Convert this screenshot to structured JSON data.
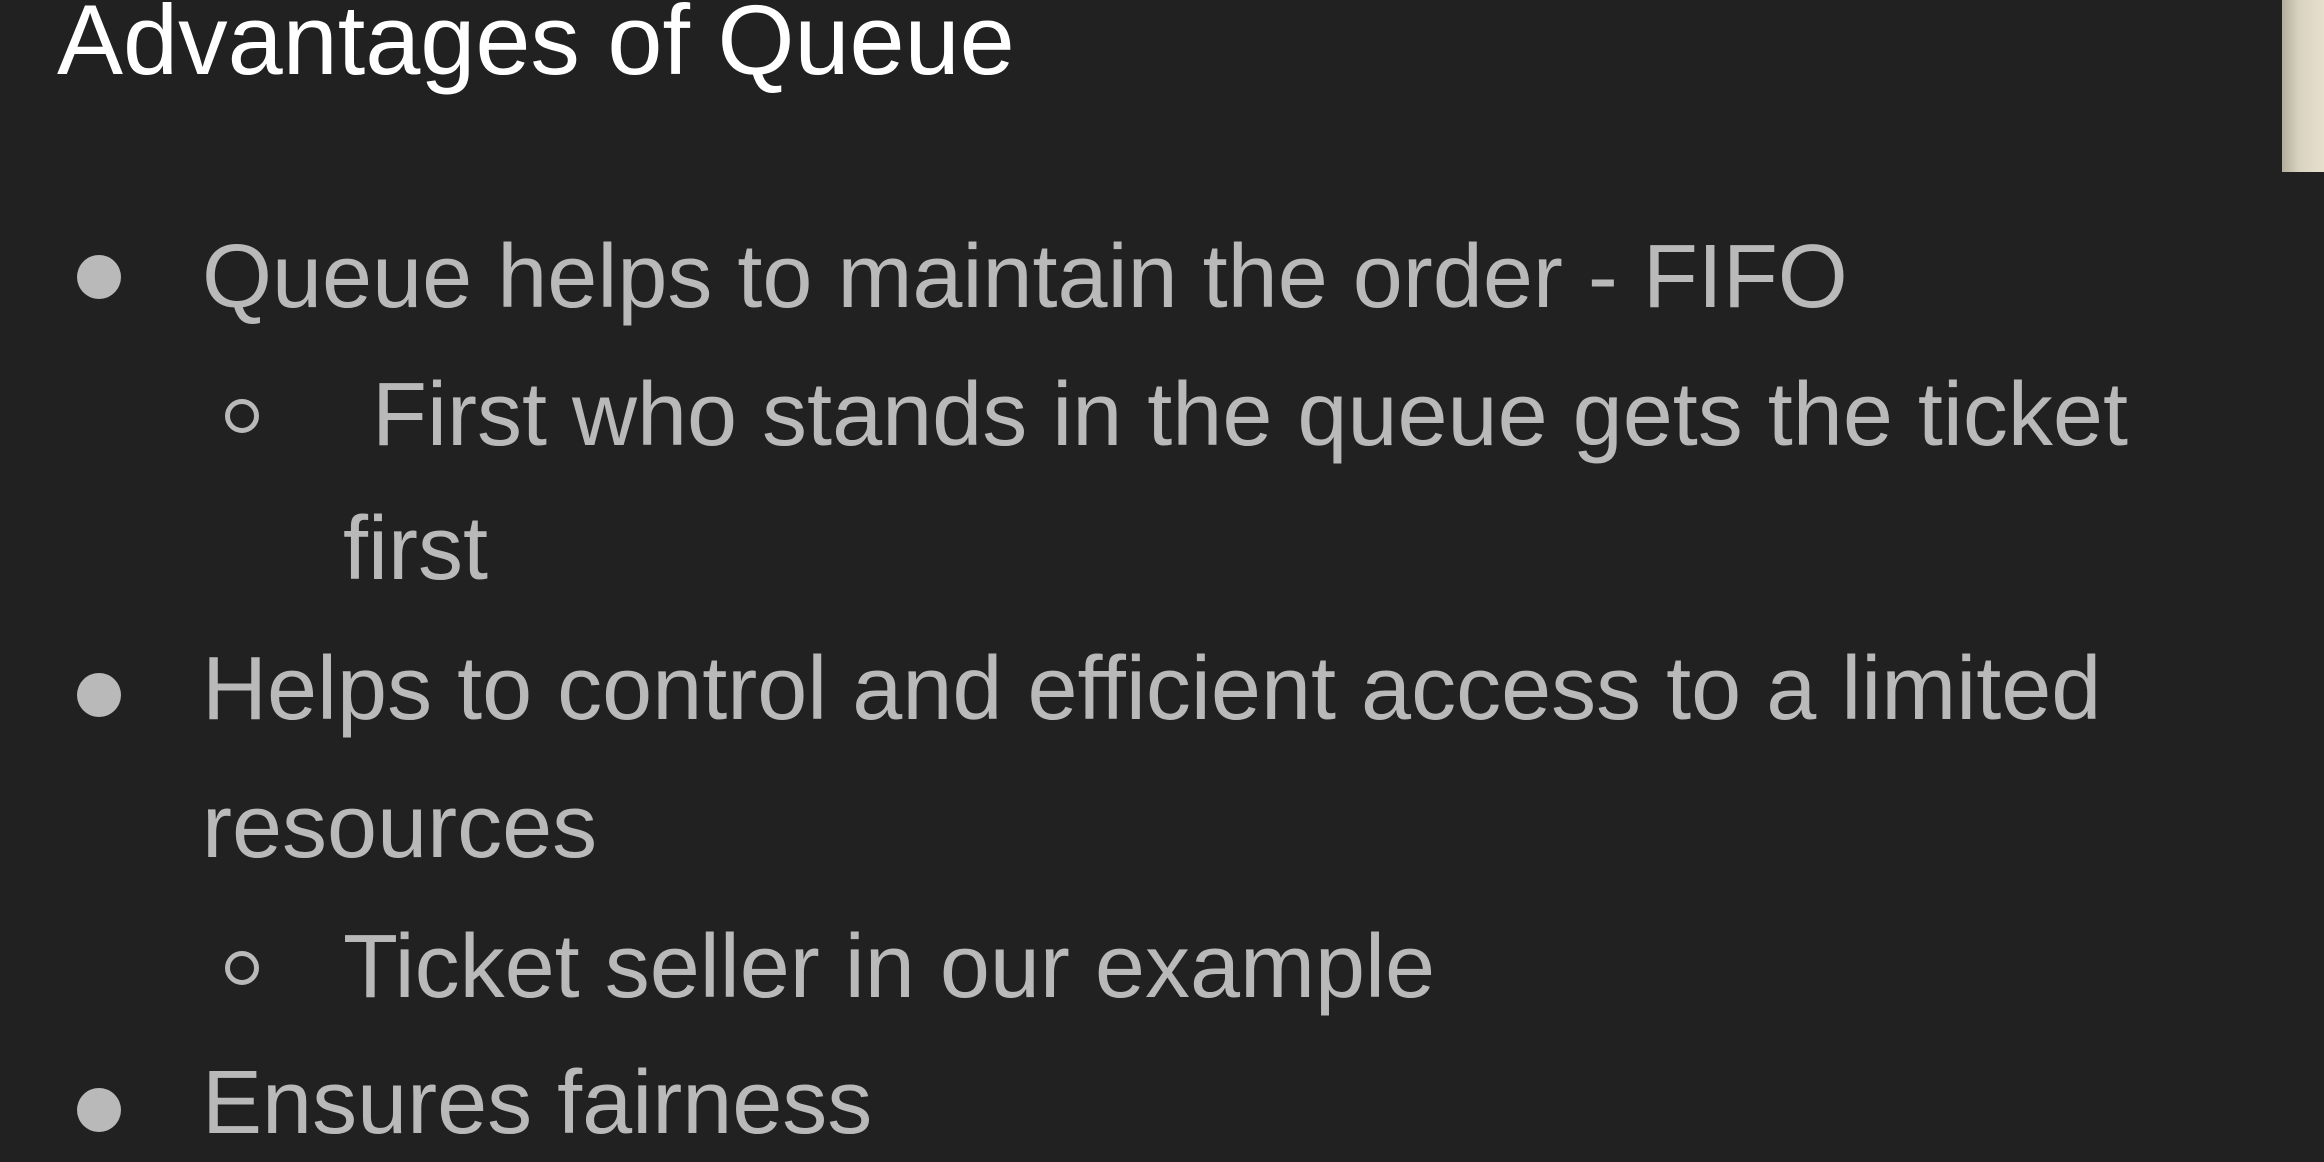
{
  "slide": {
    "title": "Advantages of Queue",
    "bullets": [
      {
        "text": "Queue helps to maintain the order - FIFO",
        "sub": [
          {
            "line1": "First who stands in the queue gets the ticket",
            "line2": "first"
          }
        ]
      },
      {
        "line1": "Helps to control and efficient access to a limited",
        "line2": "resources",
        "sub": [
          {
            "text": "Ticket seller in our example"
          }
        ]
      },
      {
        "text": "Ensures fairness"
      }
    ]
  },
  "colors": {
    "background": "#212121",
    "title": "#ffffff",
    "body_text": "#b9b9b9"
  },
  "icons": {
    "level1_bullet": "filled-circle-bullet-icon",
    "level2_bullet": "hollow-circle-bullet-icon"
  }
}
